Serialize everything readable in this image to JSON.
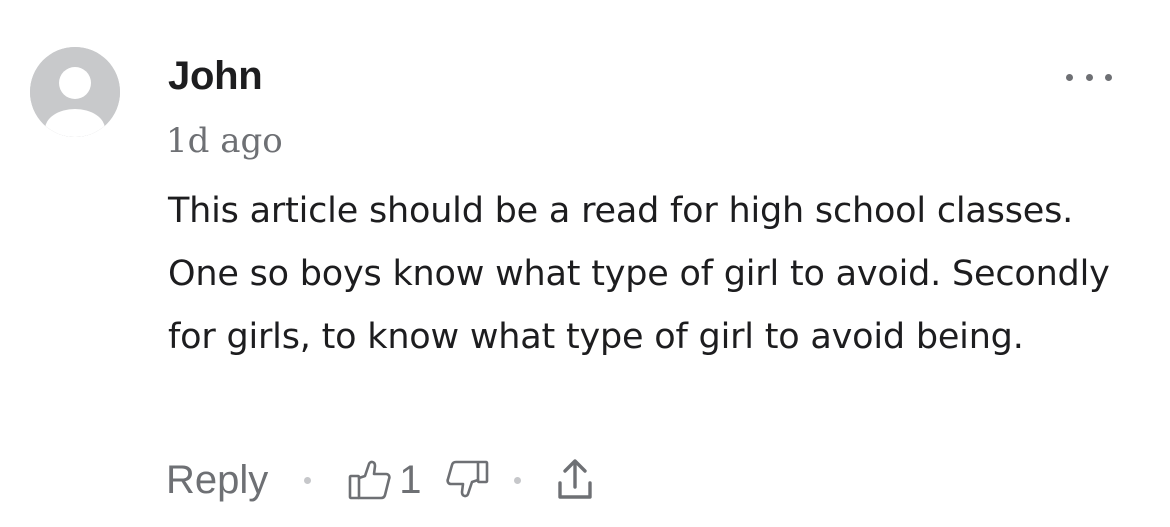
{
  "comment": {
    "author": "John",
    "timestamp": "1d ago",
    "body": "This article should be a read for high school classes. One so boys know what type of girl to avoid. Secondly for girls, to know what type of girl to avoid being.",
    "more_icon": "more-horizontal-icon",
    "avatar_icon": "default-user-avatar",
    "actions": {
      "reply_label": "Reply",
      "like_count": "1",
      "like_icon": "thumbs-up-icon",
      "dislike_icon": "thumbs-down-icon",
      "share_icon": "share-icon"
    }
  },
  "colors": {
    "text_primary": "#1d1d1f",
    "text_secondary": "#6e7074",
    "avatar_bg": "#c8c9cb",
    "separator": "#c6c7ca"
  }
}
